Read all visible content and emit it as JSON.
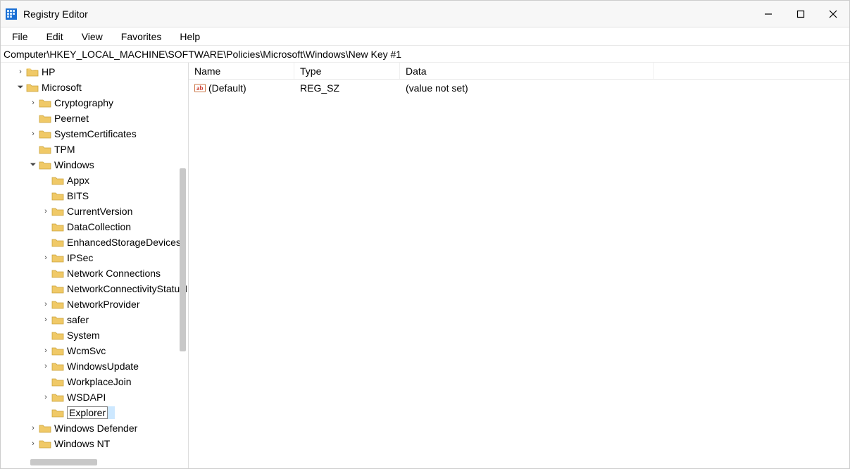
{
  "window": {
    "title": "Registry Editor"
  },
  "menubar": [
    "File",
    "Edit",
    "View",
    "Favorites",
    "Help"
  ],
  "address": "Computer\\HKEY_LOCAL_MACHINE\\SOFTWARE\\Policies\\Microsoft\\Windows\\New Key #1",
  "tree": {
    "hp": "HP",
    "microsoft": "Microsoft",
    "cryptography": "Cryptography",
    "peernet": "Peernet",
    "systemcertificates": "SystemCertificates",
    "tpm": "TPM",
    "windows": "Windows",
    "appx": "Appx",
    "bits": "BITS",
    "currentversion": "CurrentVersion",
    "datacollection": "DataCollection",
    "enhancedstorage": "EnhancedStorageDevices",
    "ipsec": "IPSec",
    "networkconnections": "Network Connections",
    "networkconnectivity": "NetworkConnectivityStatusIndicator",
    "networkprovider": "NetworkProvider",
    "safer": "safer",
    "system": "System",
    "wcmsvc": "WcmSvc",
    "windowsupdate": "WindowsUpdate",
    "workplacejoin": "WorkplaceJoin",
    "wsdapi": "WSDAPI",
    "explorer_edit": "Explorer",
    "windowsdefender": "Windows Defender",
    "windowsnt": "Windows NT"
  },
  "list": {
    "headers": {
      "name": "Name",
      "type": "Type",
      "data": "Data"
    },
    "rows": [
      {
        "name": "(Default)",
        "type": "REG_SZ",
        "data": "(value not set)"
      }
    ]
  }
}
